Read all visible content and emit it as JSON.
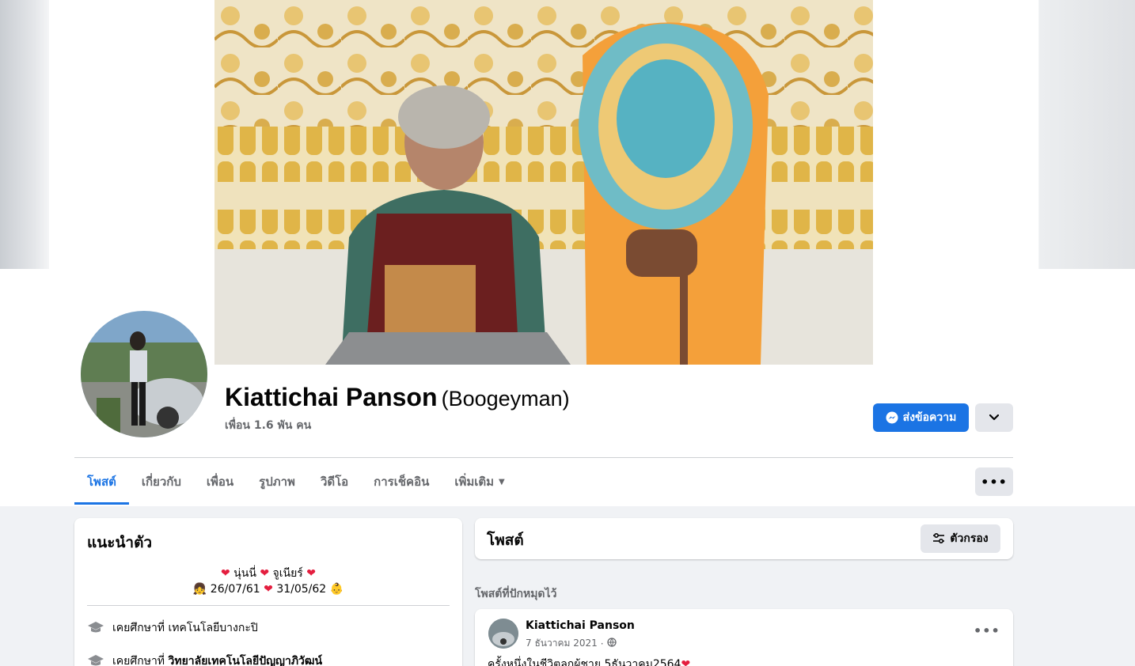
{
  "profile": {
    "name": "Kiattichai Panson",
    "alternate_name": "(Boogeyman)",
    "friends_count": "เพื่อน 1.6 พัน คน"
  },
  "actions": {
    "message_label": "ส่งข้อความ"
  },
  "tabs": [
    {
      "label": "โพสต์",
      "active": true
    },
    {
      "label": "เกี่ยวกับ"
    },
    {
      "label": "เพื่อน"
    },
    {
      "label": "รูปภาพ"
    },
    {
      "label": "วิดีโอ"
    },
    {
      "label": "การเช็คอิน"
    },
    {
      "label": "เพิ่มเติม"
    }
  ],
  "intro": {
    "title": "แนะนำตัว",
    "bio_line1": {
      "a": "นุ่นนี่",
      "b": "จูเนียร์"
    },
    "bio_line2": {
      "a": "26/07/61",
      "b": "31/05/62"
    },
    "education": [
      {
        "prefix": "เคยศึกษาที่",
        "school": "เทคโนโลยีบางกะปิ",
        "bold": false
      },
      {
        "prefix": "เคยศึกษาที่",
        "school": "วิทยาลัยเทคโนโลยีปัญญาภิวัฒน์",
        "bold": true
      }
    ]
  },
  "posts": {
    "title": "โพสต์",
    "filter_label": "ตัวกรอง",
    "pinned_label": "โพสต์ที่ปักหมุดไว้",
    "pinned_post": {
      "author": "Kiattichai Panson",
      "date": "7 ธันวาคม 2021",
      "text": "ครั้งหนึ่งในชีวิตลูกผู้ชาย 5ธันวาคม2564"
    }
  },
  "colors": {
    "accent": "#1b74e4",
    "background": "#f0f2f5",
    "heart": "#e41e3f"
  }
}
